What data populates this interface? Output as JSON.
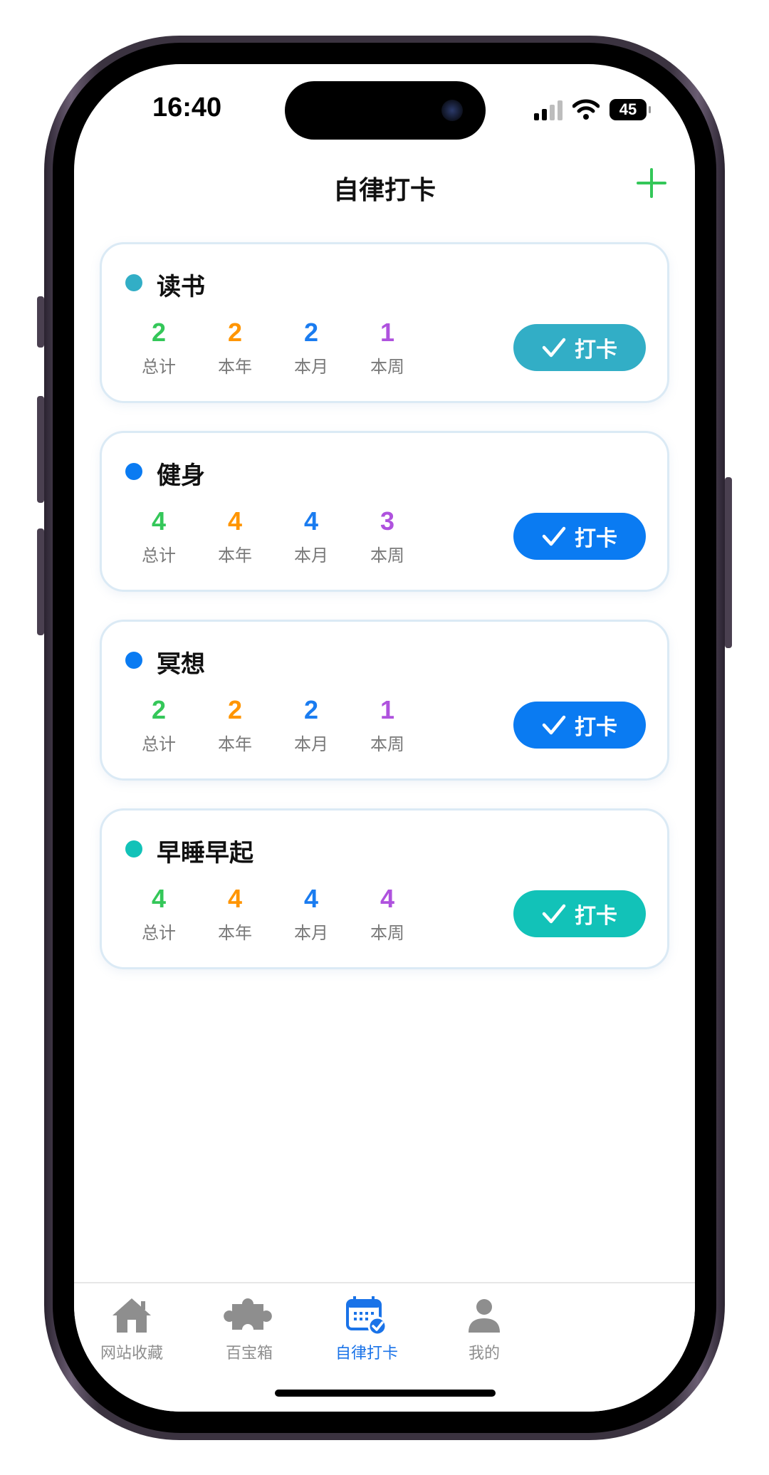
{
  "status_bar": {
    "time": "16:40",
    "battery": "45"
  },
  "header": {
    "title": "自律打卡",
    "add_icon": "plus-icon"
  },
  "stat_labels": [
    "总计",
    "本年",
    "本月",
    "本周"
  ],
  "colors": {
    "stat_total": "#34c759",
    "stat_year": "#ff9500",
    "stat_month": "#1a7cf0",
    "stat_week": "#af52de",
    "tab_active": "#1a73e8"
  },
  "habits": [
    {
      "name": "读书",
      "color": "#32aec6",
      "total": "2",
      "year": "2",
      "month": "2",
      "week": "1",
      "button": "打卡"
    },
    {
      "name": "健身",
      "color": "#0a7bf2",
      "total": "4",
      "year": "4",
      "month": "4",
      "week": "3",
      "button": "打卡"
    },
    {
      "name": "冥想",
      "color": "#0a7bf2",
      "total": "2",
      "year": "2",
      "month": "2",
      "week": "1",
      "button": "打卡"
    },
    {
      "name": "早睡早起",
      "color": "#12c2b8",
      "total": "4",
      "year": "4",
      "month": "4",
      "week": "4",
      "button": "打卡"
    }
  ],
  "tabs": [
    {
      "label": "网站收藏",
      "icon": "home-icon",
      "active": false
    },
    {
      "label": "百宝箱",
      "icon": "puzzle-icon",
      "active": false
    },
    {
      "label": "自律打卡",
      "icon": "calendar-check-icon",
      "active": true
    },
    {
      "label": "我的",
      "icon": "person-icon",
      "active": false
    }
  ]
}
